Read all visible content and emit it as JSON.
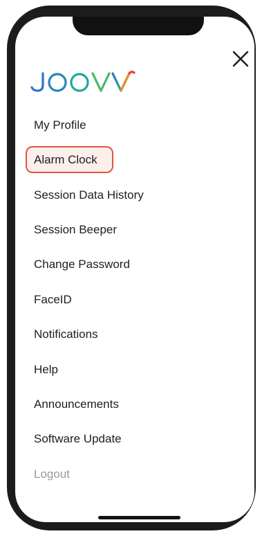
{
  "brand": {
    "logo_text": "JOOVV",
    "colors": {
      "logo_blue": "#2f72c9",
      "logo_teal": "#20a99a",
      "logo_green": "#4bb86a",
      "logo_orange": "#f08a2e",
      "logo_red": "#e8462f"
    }
  },
  "header": {
    "close_icon": "close-icon"
  },
  "menu": {
    "items": [
      {
        "label": "My Profile"
      },
      {
        "label": "Alarm Clock"
      },
      {
        "label": "Session Data History"
      },
      {
        "label": "Session Beeper"
      },
      {
        "label": "Change Password"
      },
      {
        "label": "FaceID"
      },
      {
        "label": "Notifications"
      },
      {
        "label": "Help"
      },
      {
        "label": "Announcements"
      },
      {
        "label": "Software Update"
      },
      {
        "label": "Logout"
      }
    ],
    "highlighted_item": "Alarm Clock",
    "highlight_color": "#e0553a"
  }
}
